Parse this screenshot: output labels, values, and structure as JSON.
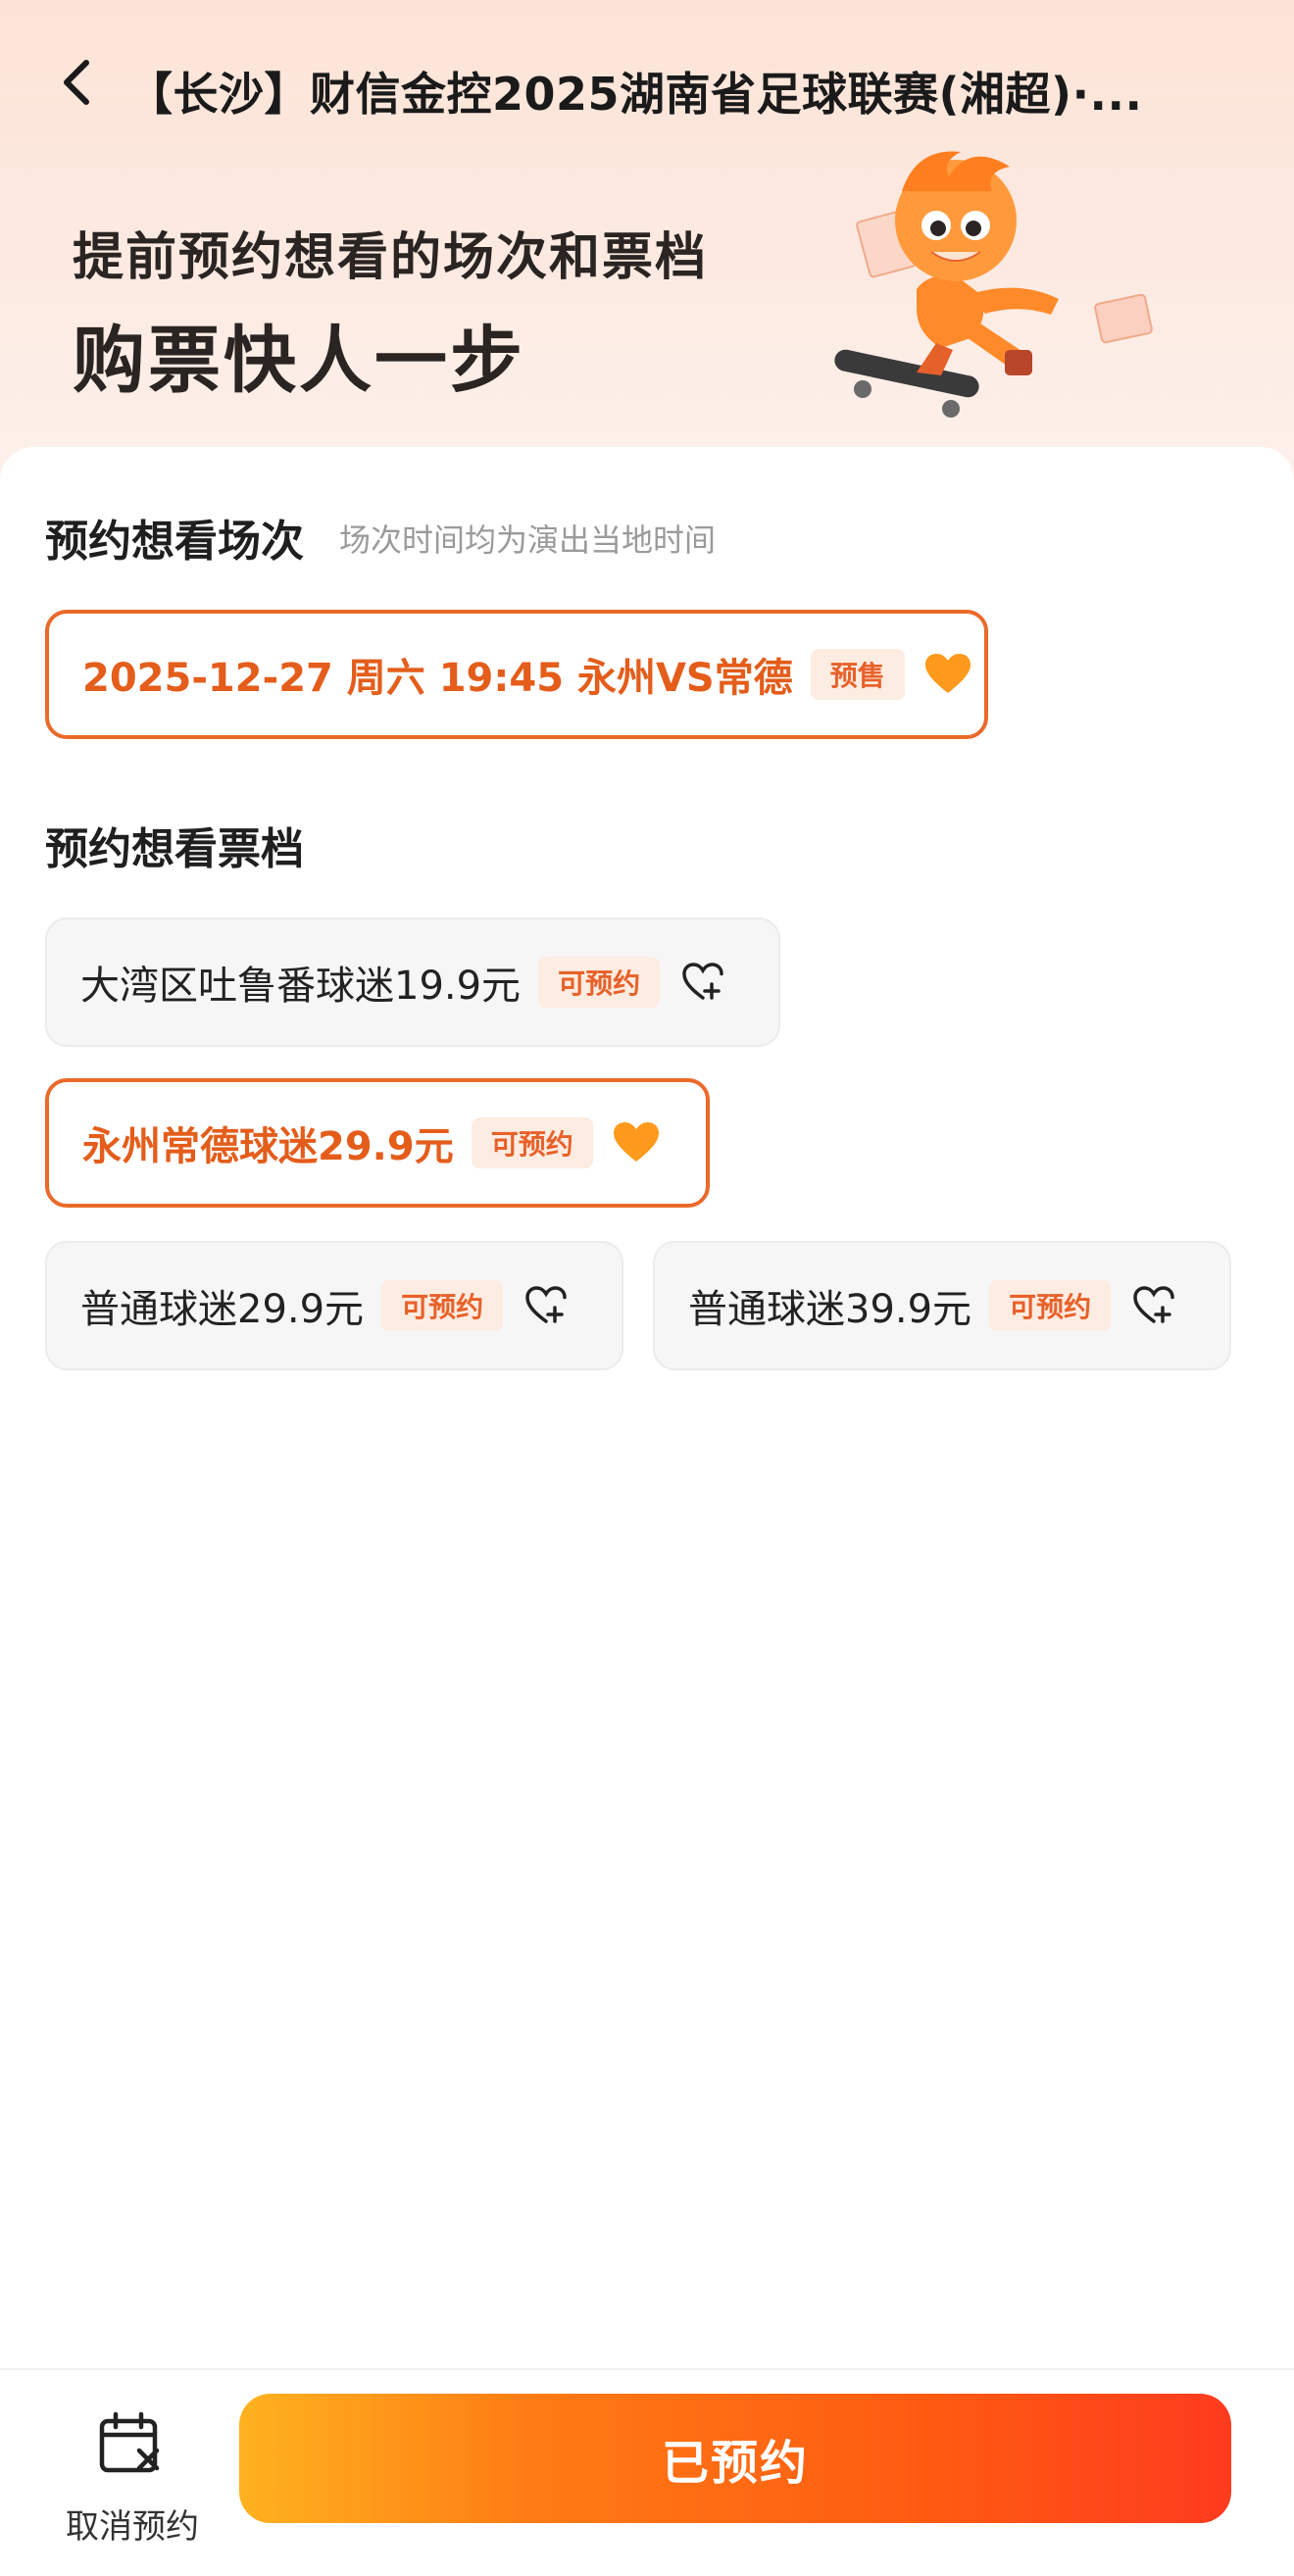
{
  "nav": {
    "title": "【长沙】财信金控2025湖南省足球联赛(湘超)·..."
  },
  "banner": {
    "line1": "提前预约想看的场次和票档",
    "line2": "购票快人一步"
  },
  "session_section": {
    "title": "预约想看场次",
    "hint": "场次时间均为演出当地时间",
    "sessions": [
      {
        "label": "2025-12-27 周六 19:45 永州VS常德",
        "tag": "预售",
        "selected": true
      }
    ]
  },
  "ticket_section": {
    "title": "预约想看票档",
    "tickets": [
      {
        "label": "大湾区吐鲁番球迷19.9元",
        "tag": "可预约",
        "selected": false
      },
      {
        "label": "永州常德球迷29.9元",
        "tag": "可预约",
        "selected": true
      },
      {
        "label": "普通球迷29.9元",
        "tag": "可预约",
        "selected": false
      },
      {
        "label": "普通球迷39.9元",
        "tag": "可预约",
        "selected": false
      }
    ]
  },
  "bottom": {
    "cancel_label": "取消预约",
    "main_label": "已预约"
  },
  "colors": {
    "accent": "#e45d1b",
    "tag_bg": "#fdece1",
    "heart": "#ff9a1c"
  }
}
